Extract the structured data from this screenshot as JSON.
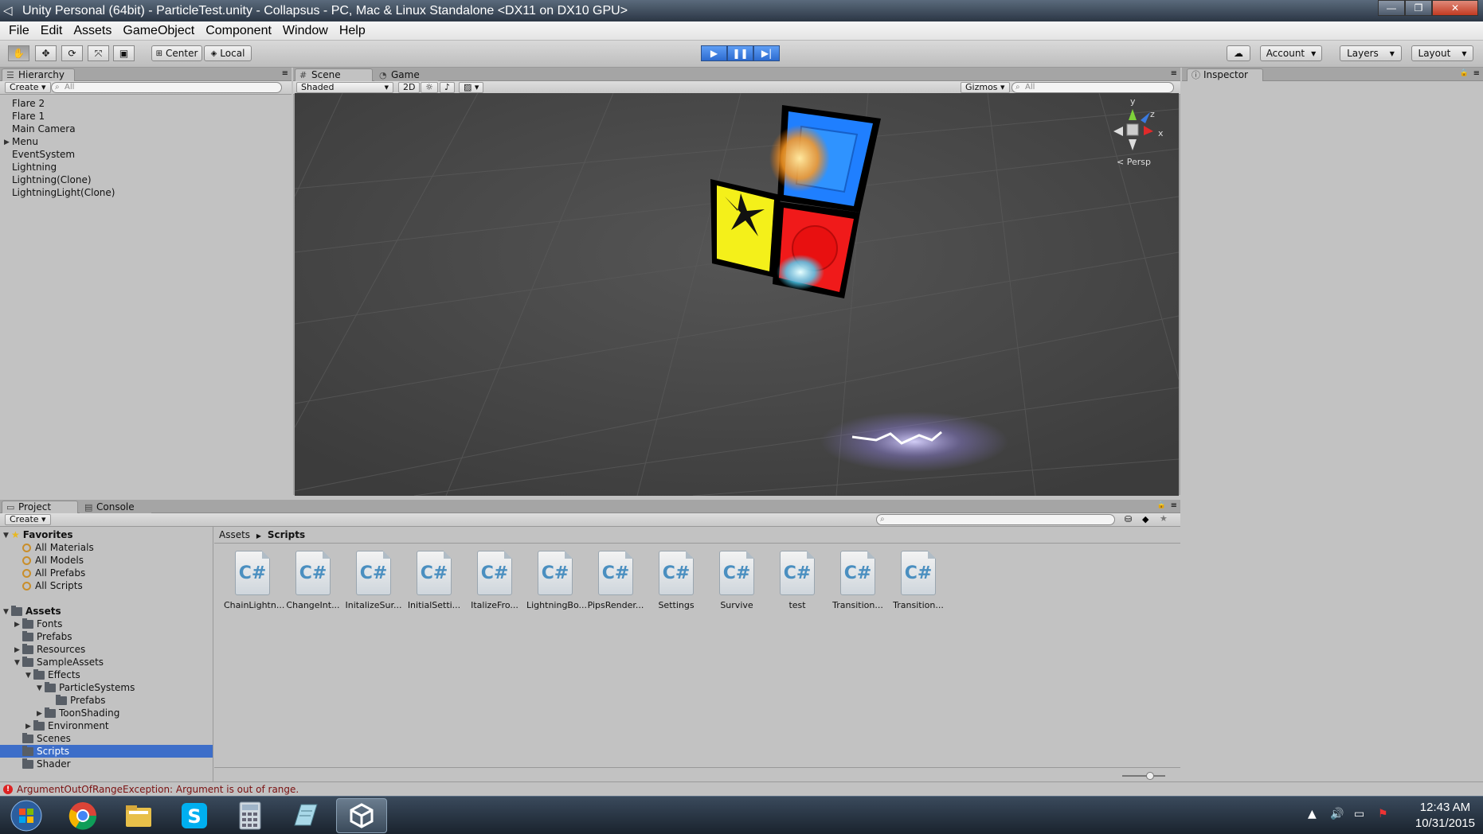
{
  "window": {
    "title": "Unity Personal (64bit) - ParticleTest.unity - Collapsus - PC, Mac & Linux Standalone <DX11 on DX10 GPU>",
    "buttons": {
      "minimize": "—",
      "maximize": "❐",
      "close": "✕"
    }
  },
  "menu": [
    "File",
    "Edit",
    "Assets",
    "GameObject",
    "Component",
    "Window",
    "Help"
  ],
  "toolbar": {
    "pivot_label": "Center",
    "space_label": "Local",
    "account_label": "Account",
    "layers_label": "Layers",
    "layout_label": "Layout"
  },
  "hierarchy": {
    "tab_label": "Hierarchy",
    "create_label": "Create",
    "search_placeholder": "All",
    "items": [
      "Flare 2",
      "Flare 1",
      "Main Camera",
      "Menu",
      "EventSystem",
      "Lightning",
      "Lightning(Clone)",
      "LightningLight(Clone)"
    ]
  },
  "scene": {
    "tab_label": "Scene",
    "game_tab_label": "Game",
    "shading_label": "Shaded",
    "twod_label": "2D",
    "gizmos_label": "Gizmos",
    "search_placeholder": "All",
    "persp_label": "Persp",
    "axis_labels": {
      "y": "y",
      "z": "z",
      "x": "x"
    }
  },
  "inspector": {
    "tab_label": "Inspector"
  },
  "project": {
    "tab_label": "Project",
    "console_tab_label": "Console",
    "create_label": "Create",
    "breadcrumb": {
      "root": "Assets",
      "current": "Scripts"
    },
    "favorites_label": "Favorites",
    "favorites": [
      "All Materials",
      "All Models",
      "All Prefabs",
      "All Scripts"
    ],
    "assets_label": "Assets",
    "tree": [
      "Fonts",
      "Prefabs",
      "Resources",
      "SampleAssets",
      "Effects",
      "ParticleSystems",
      "Prefabs",
      "ToonShading",
      "Environment",
      "Scenes",
      "Scripts",
      "Shader"
    ],
    "files": [
      "ChainLightn...",
      "ChangeInt...",
      "InitalizeSur...",
      "InitialSetti...",
      "ItalizeFro...",
      "LightningBo...",
      "PipsRender...",
      "Settings",
      "Survive",
      "test",
      "Transition...",
      "Transition..."
    ],
    "file_icon_text": "C#"
  },
  "status": {
    "error_text": "ArgumentOutOfRangeException: Argument is out of range."
  },
  "taskbar": {
    "time": "12:43 AM",
    "date": "10/31/2015"
  }
}
